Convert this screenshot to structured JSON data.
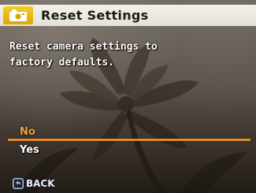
{
  "header": {
    "title": "Reset Settings",
    "menu_icon": "camera-settings-icon",
    "accent_color": "#f0b514"
  },
  "dialog": {
    "message_lines": [
      "Reset camera settings to",
      "factory defaults."
    ]
  },
  "options": {
    "items": [
      "No",
      "Yes"
    ],
    "selected": "No",
    "selected_color": "#f0a03a",
    "highlight_color": "#e8892a"
  },
  "footer": {
    "back_label": "BACK",
    "back_icon": "back-arrow-icon"
  }
}
